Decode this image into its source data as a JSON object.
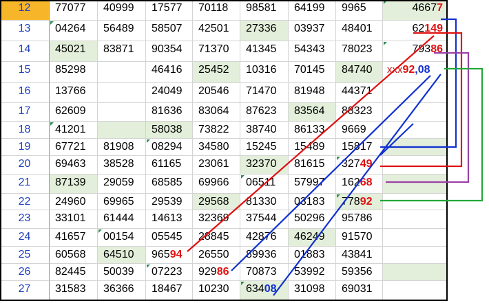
{
  "rows": [
    {
      "n": "12",
      "cells": [
        "77077",
        "40999",
        "17577",
        "70118",
        "98581",
        "64199",
        "9965"
      ],
      "last": {
        "a": "4667",
        "b": "7",
        "b_color": "red"
      }
    },
    {
      "n": "13",
      "cells": [
        "04264",
        "56489",
        "58507",
        "42501",
        "27336",
        "03937",
        "48401"
      ],
      "last": {
        "a": "62",
        "b": "149",
        "b_color": "red"
      }
    },
    {
      "n": "14",
      "cells": [
        "45021",
        "83871",
        "90354",
        "71370",
        "41345",
        "54343",
        "78023"
      ],
      "last": {
        "a": "793",
        "b": "86",
        "b_color": "red"
      }
    },
    {
      "n": "15",
      "cells": [
        "85298",
        "",
        "46416",
        "25452",
        "10316",
        "70145",
        "84740"
      ],
      "last": {
        "a": "xxx",
        "b": "92",
        "c": ",08"
      }
    },
    {
      "n": "16",
      "cells": [
        "13766",
        "",
        "24049",
        "20546",
        "71470",
        "81948",
        "44371"
      ],
      "last": {
        "a": ""
      }
    },
    {
      "n": "17",
      "cells": [
        "62609",
        "",
        "81636",
        "83064",
        "87623",
        "83564",
        "88323"
      ],
      "last": {
        "a": ""
      }
    },
    {
      "n": "18",
      "cells": [
        "41201",
        "",
        "58038",
        "73822",
        "38740",
        "86133",
        "9669"
      ],
      "last": {
        "a": ""
      }
    },
    {
      "n": "19",
      "cells": [
        "67721",
        "81908",
        "08294",
        "34580",
        "15245",
        "15489",
        "15817"
      ],
      "last": {
        "a": ""
      }
    },
    {
      "n": "20",
      "cells": [
        "69463",
        "38528",
        "61165",
        "23061",
        "32370",
        "81615",
        "327",
        "49"
      ],
      "last": {
        "a": ""
      }
    },
    {
      "n": "21",
      "cells": [
        "87139",
        "29059",
        "68585",
        "69966",
        "06511",
        "57997",
        "162",
        "68"
      ],
      "last": {
        "a": ""
      }
    },
    {
      "n": "22",
      "cells": [
        "24960",
        "69965",
        "29539",
        "29568",
        "81330",
        "03183",
        "778",
        "92"
      ],
      "last": {
        "a": ""
      }
    },
    {
      "n": "23",
      "cells": [
        "33101",
        "61444",
        "14613",
        "32369",
        "37544",
        "50296",
        "95786"
      ],
      "last": {
        "a": ""
      }
    },
    {
      "n": "24",
      "cells": [
        "41657",
        "00154",
        "05545",
        "28845",
        "42876",
        "46249",
        "91570"
      ],
      "last": {
        "a": ""
      }
    },
    {
      "n": "25",
      "cells": [
        "60568",
        "64510",
        "965",
        "26550",
        "89936",
        "01883",
        "43841"
      ],
      "last": {
        "a": ""
      }
    },
    {
      "n": "26",
      "cells": [
        "82445",
        "50039",
        "07223",
        "929",
        "70873",
        "53992",
        "59356"
      ],
      "last": {
        "a": ""
      }
    },
    {
      "n": "27",
      "cells": [
        "31583",
        "36366",
        "18467",
        "10230",
        "634",
        "31098",
        "69031"
      ],
      "last": {
        "a": ""
      }
    }
  ],
  "suffixes": {
    "r20c7": "49",
    "r21c7": "68",
    "r22c7": "92",
    "r25c3": "94",
    "r26c4": "86",
    "r27c5": "08"
  },
  "colors": {
    "red": "#e01010",
    "blue": "#1030d0",
    "purple": "#9b40a8",
    "green": "#22a83a",
    "selected_row_header": "#f7b62a",
    "highlight_cell": "#e3efda"
  }
}
